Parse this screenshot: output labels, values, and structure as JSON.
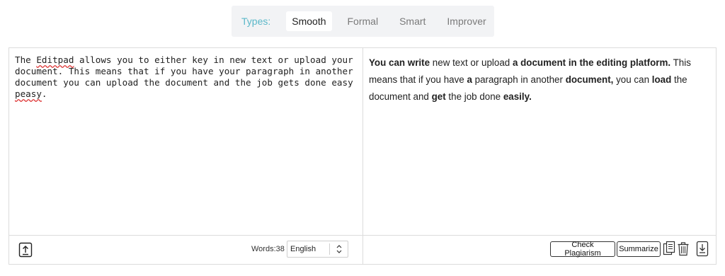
{
  "types": {
    "label": "Types:",
    "tabs": [
      {
        "label": "Smooth",
        "active": true
      },
      {
        "label": "Formal",
        "active": false
      },
      {
        "label": "Smart",
        "active": false
      },
      {
        "label": "Improver",
        "active": false
      }
    ]
  },
  "input": {
    "text_parts": [
      "The ",
      "Editpad",
      " allows you to either key in new text or upload your document. This means that if you have your paragraph in another document you can upload the document and the job gets done easy ",
      "peasy",
      "."
    ]
  },
  "output": {
    "segments": [
      {
        "text": "You can write",
        "bold": true
      },
      {
        "text": " new text or upload ",
        "bold": false
      },
      {
        "text": "a document in the editing platform.",
        "bold": true
      },
      {
        "text": " This means that if you have ",
        "bold": false
      },
      {
        "text": "a",
        "bold": true
      },
      {
        "text": " paragraph in another ",
        "bold": false
      },
      {
        "text": "document,",
        "bold": true
      },
      {
        "text": " you can ",
        "bold": false
      },
      {
        "text": "load",
        "bold": true
      },
      {
        "text": " the document and ",
        "bold": false
      },
      {
        "text": "get",
        "bold": true
      },
      {
        "text": " the job done ",
        "bold": false
      },
      {
        "text": "easily.",
        "bold": true
      }
    ]
  },
  "footer_left": {
    "upload_icon": "upload-icon",
    "words_label": "Words:38",
    "language": "English"
  },
  "footer_right": {
    "check_plagiarism": "Check Plagiarism",
    "summarize": "Summarize",
    "icons": [
      "copy-icon",
      "trash-icon",
      "download-icon"
    ]
  },
  "colors": {
    "types_label": "#5bb8c9",
    "spell_error": "#d33"
  }
}
